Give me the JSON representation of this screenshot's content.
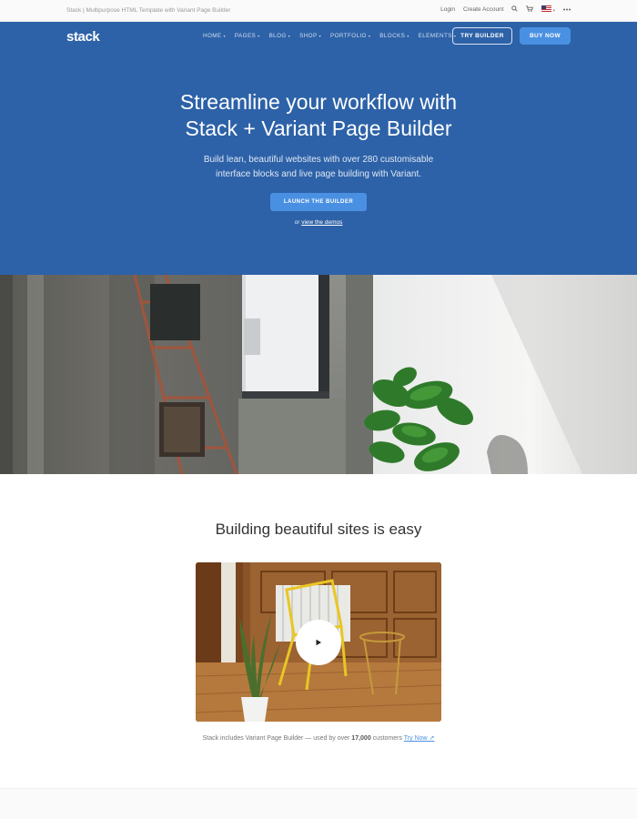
{
  "topbar": {
    "tagline": "Stack | Multipurpose HTML Template with Variant Page Builder",
    "login": "Login",
    "create_account": "Create Account"
  },
  "header": {
    "logo": "stack",
    "nav": [
      "HOME",
      "PAGES",
      "BLOG",
      "SHOP",
      "PORTFOLIO",
      "BLOCKS",
      "ELEMENTS"
    ],
    "try_builder": "TRY BUILDER",
    "buy_now": "BUY NOW"
  },
  "hero": {
    "title_line1": "Streamline your workflow with",
    "title_line2": "Stack + Variant Page Builder",
    "sub_line1": "Build lean, beautiful websites with over 280 customisable",
    "sub_line2": "interface blocks and live page building with Variant.",
    "cta": "LAUNCH THE BUILDER",
    "or_text": "or",
    "demos_link": "view the demos"
  },
  "section": {
    "title": "Building beautiful sites is easy",
    "caption_prefix": "Stack includes Variant Page Builder — used by over",
    "caption_count": "17,000",
    "caption_suffix": "customers",
    "try_now": "Try Now ↗"
  },
  "icons": {
    "search": "search-icon",
    "cart": "cart-icon",
    "flag": "us-flag-icon",
    "more": "more-icon",
    "play": "play-icon"
  },
  "colors": {
    "hero_bg": "#2d62a8",
    "accent": "#4a90e2"
  }
}
